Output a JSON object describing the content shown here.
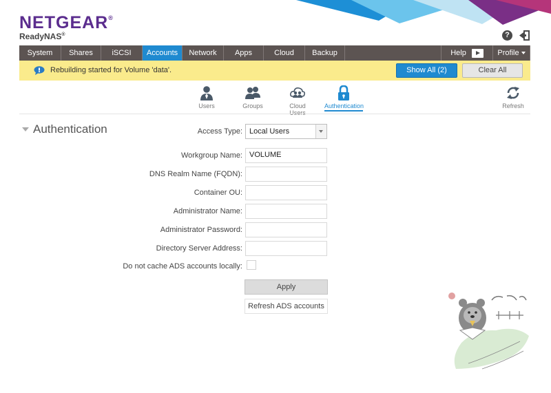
{
  "brand": {
    "logo": "NETGEAR",
    "logo_mark": "®",
    "product": "ReadyNAS",
    "product_mark": "®"
  },
  "header_icons": {
    "help": "help-circle-icon",
    "help_glyph": "?",
    "logout": "logout-icon"
  },
  "nav": {
    "items": [
      "System",
      "Shares",
      "iSCSI",
      "Accounts",
      "Network",
      "Apps",
      "Cloud",
      "Backup"
    ],
    "active": "Accounts",
    "help_label": "Help",
    "profile_label": "Profile"
  },
  "alert": {
    "message": "Rebuilding started for Volume 'data'.",
    "show_all": "Show All (2)",
    "clear_all": "Clear All"
  },
  "subtabs": [
    {
      "label": "Users",
      "icon": "user-icon"
    },
    {
      "label": "Groups",
      "icon": "group-icon"
    },
    {
      "label": "Cloud Users",
      "icon": "cloud-users-icon"
    },
    {
      "label": "Authentication",
      "icon": "lock-icon"
    }
  ],
  "refresh_label": "Refresh",
  "section": {
    "title": "Authentication"
  },
  "form": {
    "access_type_label": "Access Type:",
    "access_type_value": "Local Users",
    "workgroup_label": "Workgroup Name:",
    "workgroup_value": "VOLUME",
    "dns_label": "DNS Realm Name (FQDN):",
    "container_label": "Container OU:",
    "admin_name_label": "Administrator Name:",
    "admin_password_label": "Administrator Password:",
    "dir_server_label": "Directory Server Address:",
    "no_cache_label": "Do not cache ADS accounts locally:",
    "apply": "Apply",
    "refresh_ads": "Refresh ADS accounts"
  },
  "colors": {
    "accent": "#1f8ad0",
    "nav_bg": "#5c5452",
    "alert_bg": "#faeb8c",
    "brand": "#5b2d8e"
  }
}
